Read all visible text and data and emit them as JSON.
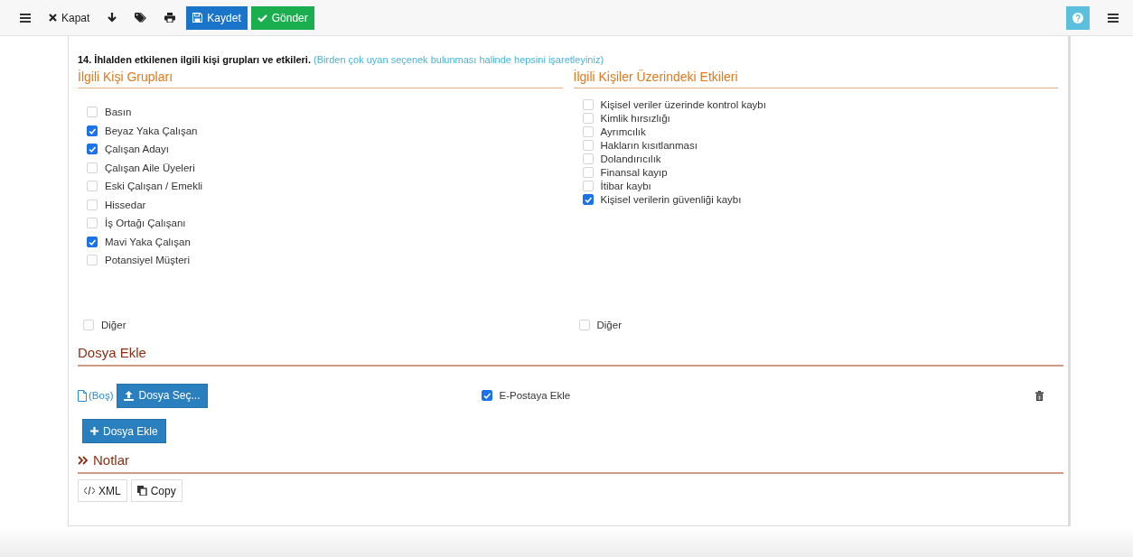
{
  "toolbar": {
    "items": [
      {
        "kind": "plain",
        "label": "Kapat"
      },
      {
        "kind": "primary",
        "label": "Kaydet"
      },
      {
        "kind": "success",
        "label": "Gönder"
      }
    ]
  },
  "question": {
    "title": "14. İhlalden etkilenen ilgili kişi grupları ve etkileri.",
    "hint": "(Birden çok uyan seçenek bulunması halinde hepsini işaretleyiniz)"
  },
  "columns": [
    {
      "heading": "İlgili Kişi Grupları",
      "options": [
        {
          "label": "Basın",
          "checked": false
        },
        {
          "label": "Beyaz Yaka Çalışan",
          "checked": true
        },
        {
          "label": "Çalışan Adayı",
          "checked": true
        },
        {
          "label": "Çalışan Aile Üyeleri",
          "checked": false
        },
        {
          "label": "Eski Çalışan / Emekli",
          "checked": false
        },
        {
          "label": "Hissedar",
          "checked": false
        },
        {
          "label": "İş Ortağı Çalışanı",
          "checked": false
        },
        {
          "label": "Mavi Yaka Çalışan",
          "checked": true
        },
        {
          "label": "Potansiyel Müşteri",
          "checked": false
        }
      ],
      "other": {
        "label": "Diğer",
        "checked": false
      }
    },
    {
      "heading": "İlgili Kişiler Üzerindeki Etkileri",
      "options": [
        {
          "label": "Kişisel veriler üzerinde kontrol kaybı",
          "checked": false
        },
        {
          "label": "Kimlik hırsızlığı",
          "checked": false
        },
        {
          "label": "Ayrımcılık",
          "checked": false
        },
        {
          "label": "Hakların kısıtlanması",
          "checked": false
        },
        {
          "label": "Dolandırıcılık",
          "checked": false
        },
        {
          "label": "Finansal kayıp",
          "checked": false
        },
        {
          "label": "İtibar kaybı",
          "checked": false
        },
        {
          "label": "Kişisel verilerin güvenliği kaybı",
          "checked": true
        }
      ],
      "other": {
        "label": "Diğer",
        "checked": false
      }
    }
  ],
  "attachments": {
    "heading": "Dosya Ekle",
    "file_name": "(Boş)",
    "choose_button": "Dosya Seç...",
    "email": {
      "label": "E-Postaya Ekle",
      "checked": true
    },
    "add_button": "Dosya Ekle"
  },
  "notes": {
    "heading": "Notlar"
  },
  "footer": {
    "buttons": [
      {
        "kind": "xml",
        "label": "XML"
      },
      {
        "kind": "copy",
        "label": "Copy"
      }
    ]
  }
}
